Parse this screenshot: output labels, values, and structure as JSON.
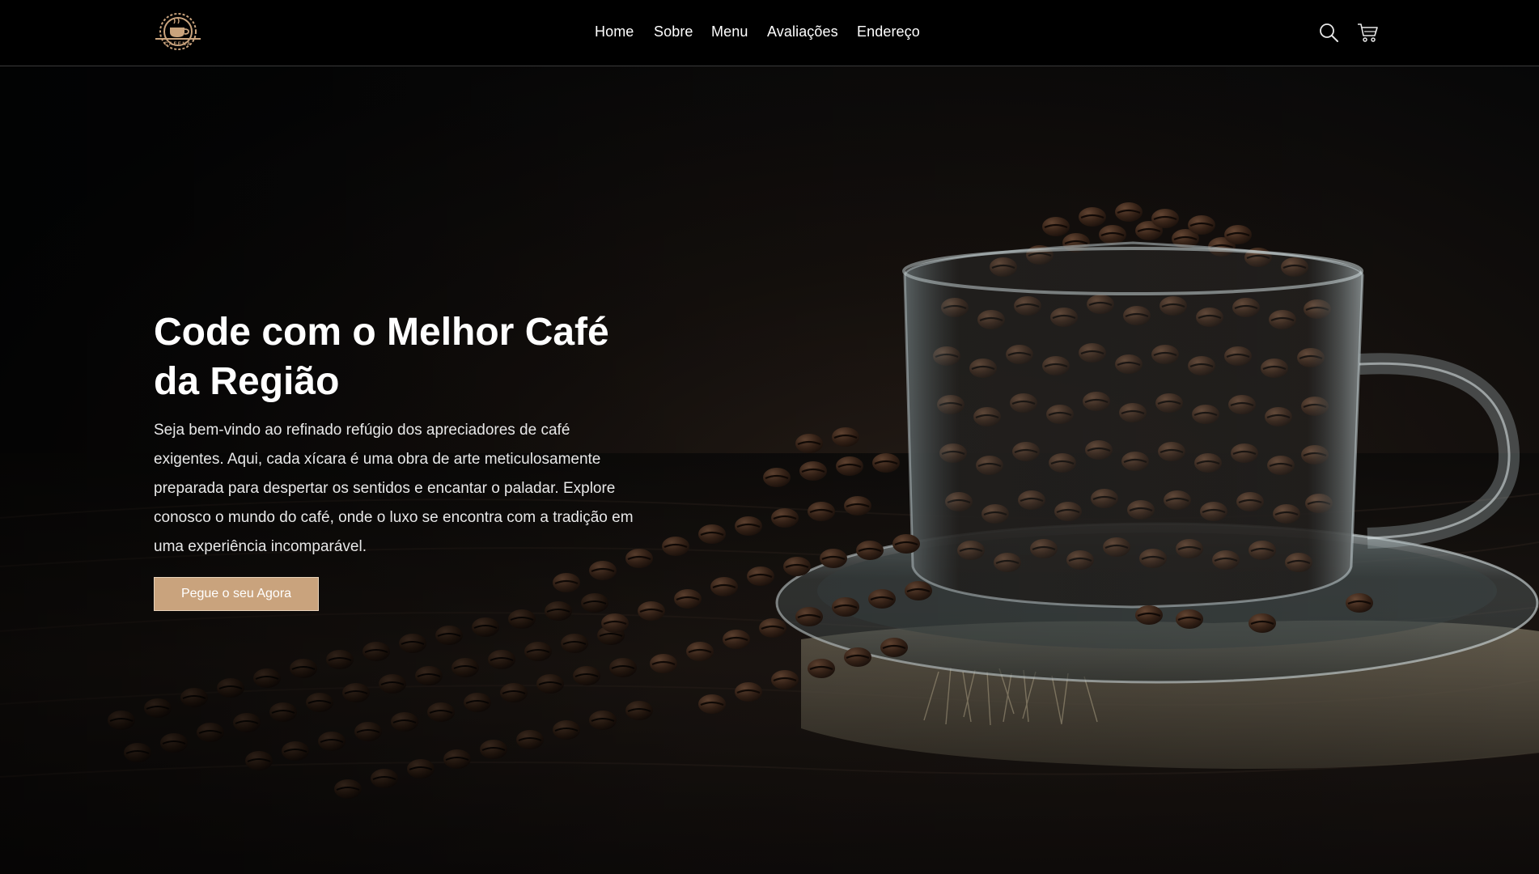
{
  "brand": {
    "logo_text": "CAFENA"
  },
  "nav": {
    "items": [
      {
        "label": "Home"
      },
      {
        "label": "Sobre"
      },
      {
        "label": "Menu"
      },
      {
        "label": "Avaliações"
      },
      {
        "label": "Endereço"
      }
    ]
  },
  "header_icons": {
    "search": "search-icon",
    "cart": "cart-icon"
  },
  "hero": {
    "title_line1": "Code com o Melhor Café",
    "title_line2": "da Região",
    "description": "Seja bem-vindo ao refinado refúgio dos apreciadores de café exigentes. Aqui, cada xícara é uma obra de arte meticulosamente preparada para despertar os sentidos e encantar o paladar. Explore conosco o mundo do café, onde o luxo se encontra com a tradição em uma experiência incomparável.",
    "cta_label": "Pegue o seu Agora",
    "background_image": "coffee-beans-glass-cup"
  },
  "colors": {
    "background": "#060708",
    "header_bg": "#000000",
    "accent": "#c9a37d",
    "text": "#ffffff"
  }
}
